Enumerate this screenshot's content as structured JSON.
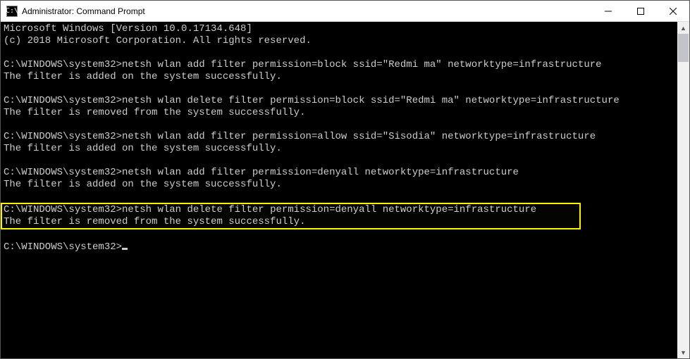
{
  "window": {
    "title": "Administrator: Command Prompt",
    "icon_label": "C:\\"
  },
  "terminal": {
    "header1": "Microsoft Windows [Version 10.0.17134.648]",
    "header2": "(c) 2018 Microsoft Corporation. All rights reserved.",
    "prompt": "C:\\WINDOWS\\system32>",
    "cmd1": "netsh wlan add filter permission=block ssid=\"Redmi ma\" networktype=infrastructure",
    "out1": "The filter is added on the system successfully.",
    "cmd2": "netsh wlan delete filter permission=block ssid=\"Redmi ma\" networktype=infrastructure",
    "out2": "The filter is removed from the system successfully.",
    "cmd3": "netsh wlan add filter permission=allow ssid=\"Sisodia\" networktype=infrastructure",
    "out3": "The filter is added on the system successfully.",
    "cmd4": "netsh wlan add filter permission=denyall networktype=infrastructure",
    "out4": "The filter is added on the system successfully.",
    "cmd5": "netsh wlan delete filter permission=denyall networktype=infrastructure",
    "out5": "The filter is removed from the system successfully."
  }
}
